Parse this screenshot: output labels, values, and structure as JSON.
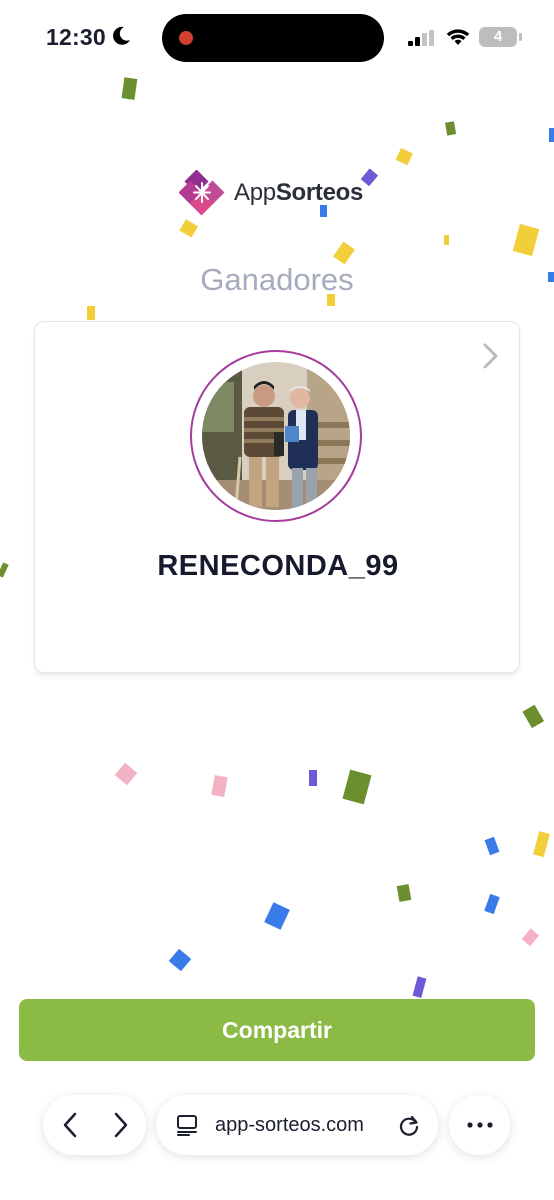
{
  "status_bar": {
    "time": "12:30",
    "battery": "4",
    "icons": [
      "moon-icon",
      "cellular-signal-icon",
      "wifi-icon",
      "battery-icon"
    ]
  },
  "brand": {
    "name_light": "App",
    "name_bold": "Sorteos",
    "logo_icon": "appsorteos-logo-icon"
  },
  "section": {
    "title": "Ganadores"
  },
  "winner_card": {
    "username": "RENECONDA_99",
    "avatar": "winner-photo",
    "chevron_icon": "chevron-right-icon"
  },
  "actions": {
    "share_label": "Compartir"
  },
  "browser_bar": {
    "url": "app-sorteos.com",
    "icons": [
      "back-icon",
      "forward-icon",
      "tabs-icon",
      "reload-icon",
      "more-icon"
    ]
  },
  "colors": {
    "accent_green": "#8bbb44",
    "title_gray": "#a6abbd",
    "ring_purple": "#a23d9b",
    "logo_purple": "#8e2f8f",
    "logo_pink": "#d94a8c",
    "confetti": [
      "#6b8f2f",
      "#f2cf3a",
      "#6c5bd6",
      "#3a7bea",
      "#f3b2c3"
    ]
  }
}
